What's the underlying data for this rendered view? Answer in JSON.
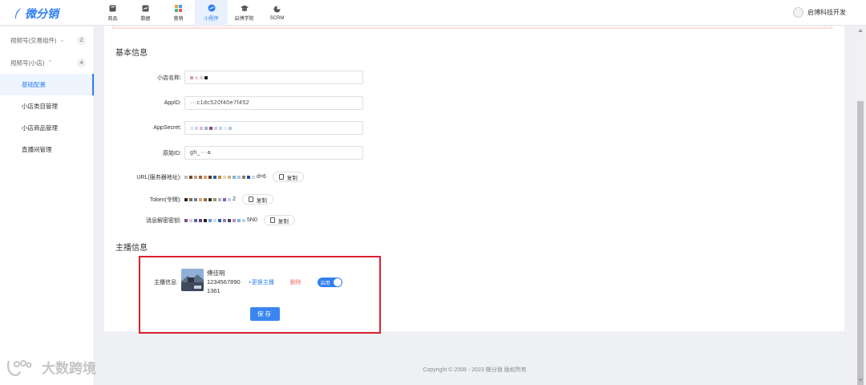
{
  "brand": {
    "name": "微分销",
    "color": "#2f7ff0"
  },
  "nav": [
    {
      "label": "商品",
      "icon": "goods-icon"
    },
    {
      "label": "数据",
      "icon": "data-icon"
    },
    {
      "label": "营销",
      "icon": "marketing-icon"
    },
    {
      "label": "小程序",
      "icon": "mini-program-icon",
      "active": true
    },
    {
      "label": "启博学院",
      "icon": "graduation-cap-icon"
    },
    {
      "label": "SCRM",
      "icon": "pie-chart-icon"
    }
  ],
  "user": {
    "name": "启博科技开发"
  },
  "sidebar": {
    "groups": [
      {
        "label": "视频号(交易组件)",
        "count": "2",
        "expanded": false
      },
      {
        "label": "视频号(小店)",
        "count": "4",
        "expanded": true
      }
    ],
    "items": [
      {
        "label": "基础配置",
        "active": true
      },
      {
        "label": "小店类目管理"
      },
      {
        "label": "小店商品管理"
      },
      {
        "label": "直播间管理"
      }
    ]
  },
  "basic": {
    "title": "基本信息",
    "shop_name_label": "小店名称:",
    "appid_label": "AppID:",
    "appid_value": "···c1dc520f40e7f452",
    "appsecret_label": "AppSecret:",
    "orig_id_label": "原始ID:",
    "orig_id_value": "gh_···a",
    "url_label": "URL(服务器地址):",
    "url_tail": "d=6",
    "token_label": "Token(令牌):",
    "token_tail": "2",
    "aes_label": "消息解密密钥:",
    "aes_tail": "5N0",
    "copy_label": "复制"
  },
  "host": {
    "title": "主播信息",
    "label": "主播信息:",
    "name": "傅佳明",
    "phone": "1234567890",
    "extra": "1361",
    "change_label": "+更换主播",
    "delete_label": "删除",
    "toggle_label": "启用",
    "toggle_on": true
  },
  "save_label": "保存",
  "footer": "Copyright © 2008 - 2023 微分销 版权所有",
  "watermark": "大数跨境",
  "colors": {
    "accent": "#2f7ff0",
    "danger": "#f56c6c",
    "highlight_box": "#d9232e"
  }
}
